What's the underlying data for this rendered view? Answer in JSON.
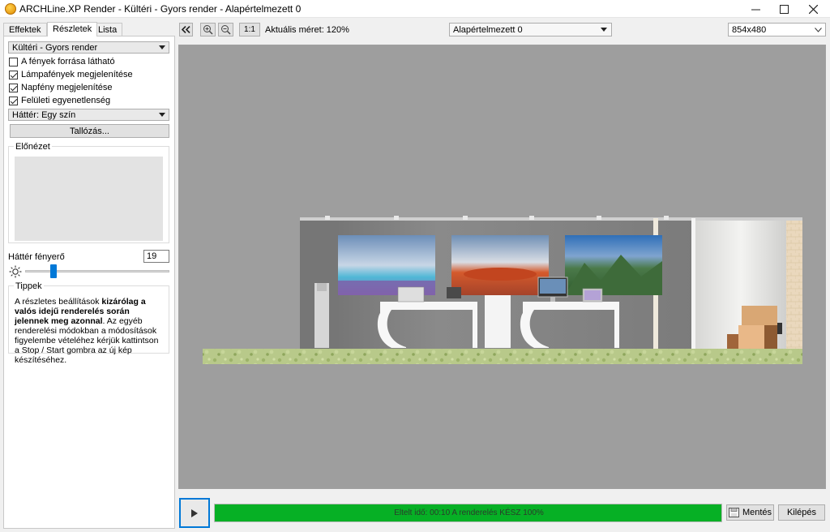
{
  "window": {
    "title": "ARCHLine.XP Render - Kültéri - Gyors render - Alapértelmezett 0",
    "minimize_glyph": "—",
    "maximize_glyph": "☐",
    "close_glyph": "✕"
  },
  "tabs": [
    {
      "label": "Effektek",
      "active": false
    },
    {
      "label": "Részletek",
      "active": true
    },
    {
      "label": "Lista",
      "active": false
    }
  ],
  "details": {
    "preset_select": "Kültéri - Gyors render",
    "checkboxes": [
      {
        "label": "A fények forrása látható",
        "checked": false
      },
      {
        "label": "Lámpafények megjelenítése",
        "checked": true
      },
      {
        "label": "Napfény megjelenítése",
        "checked": true
      },
      {
        "label": "Felületi egyenetlenség",
        "checked": true
      }
    ],
    "background_select": "Háttér: Egy szín",
    "browse_button": "Tallózás...",
    "preview_label": "Előnézet",
    "brightness_label": "Háttér fényerő",
    "brightness_value": "19",
    "brightness_fraction": 0.19,
    "tips_label": "Tippek",
    "tips_normal_1": "A részletes beállítások ",
    "tips_bold": "kizárólag a valós idejű renderelés során jelennek meg azonnal",
    "tips_normal_2": ". Az egyéb renderelési módokban a módosítások figyelembe vételéhez kérjük kattintson a Stop / Start gombra az új kép készítéséhez."
  },
  "toolbar": {
    "collapse_glyph": "«",
    "one_to_one": "1:1",
    "zoom_label": "Aktuális méret: 120%",
    "view_select": "Alapértelmezett 0",
    "resolution_select": "854x480"
  },
  "bottom": {
    "progress_text": "Eltelt idő: 00:10  A renderelés KÉSZ  100%",
    "progress_fraction": 1.0,
    "save_button": "Mentés",
    "exit_button": "Kilépés"
  },
  "colors": {
    "accent": "#0078d7",
    "progress": "#06b025",
    "viewport_bg": "#9e9e9e"
  }
}
